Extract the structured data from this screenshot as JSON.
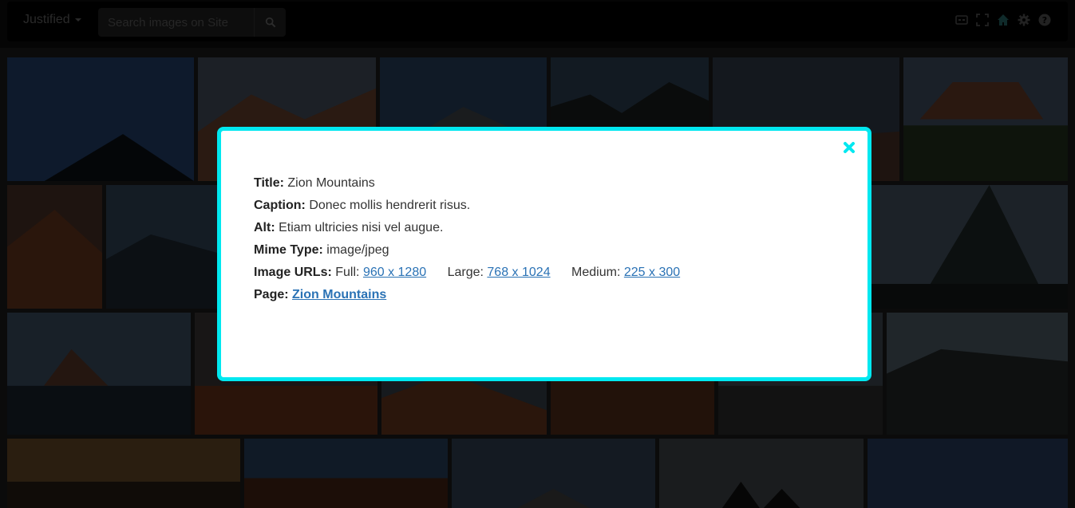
{
  "toolbar": {
    "mode_label": "Justified",
    "search_placeholder": "Search images on Site",
    "icons": [
      "caption-icon",
      "fullscreen-icon",
      "home-icon",
      "gear-icon",
      "help-icon"
    ]
  },
  "modal": {
    "title_label": "Title:",
    "title_value": "Zion Mountains",
    "caption_label": "Caption:",
    "caption_value": "Donec mollis hendrerit risus.",
    "alt_label": "Alt:",
    "alt_value": "Etiam ultricies nisi vel augue.",
    "mime_label": "Mime Type:",
    "mime_value": "image/jpeg",
    "urls_label": "Image URLs:",
    "full_label": "Full:",
    "full_link": "960 x 1280",
    "large_label": "Large:",
    "large_link": "768 x 1024",
    "medium_label": "Medium:",
    "medium_link": "225 x 300",
    "page_label": "Page:",
    "page_link": "Zion Mountains"
  },
  "colors": {
    "accent_border": "#00e8f0",
    "link": "#2a72b5"
  }
}
